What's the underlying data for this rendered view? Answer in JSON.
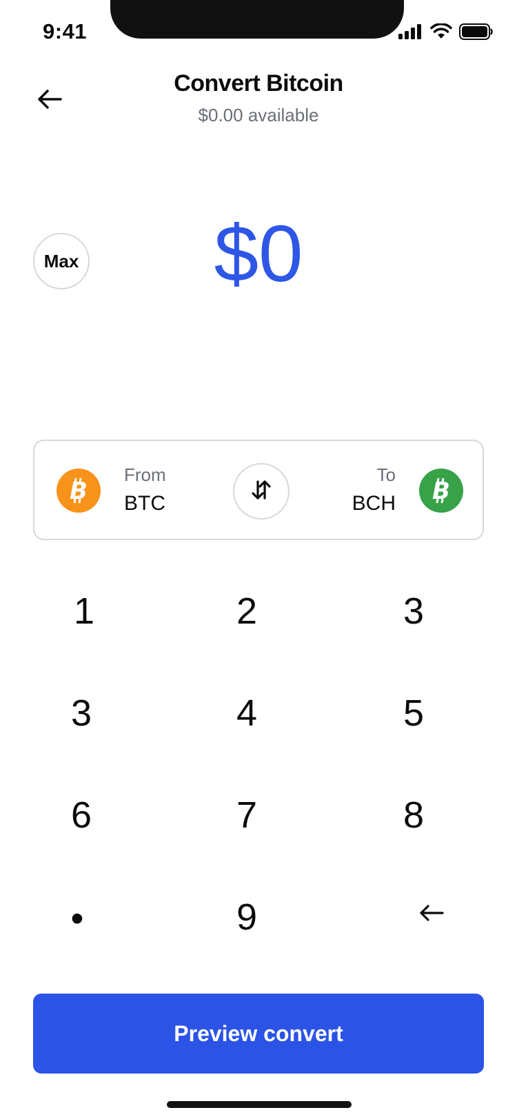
{
  "status_bar": {
    "time": "9:41"
  },
  "header": {
    "title": "Convert Bitcoin",
    "subtitle": "$0.00 available"
  },
  "amount": {
    "max_label": "Max",
    "value": "$0",
    "color": "#2f57e6"
  },
  "convert": {
    "from_label": "From",
    "from_symbol": "BTC",
    "from_icon": "bitcoin-icon",
    "from_color": "#f7931a",
    "to_label": "To",
    "to_symbol": "BCH",
    "to_icon": "bitcoin-cash-icon",
    "to_color": "#38a249"
  },
  "keypad": {
    "keys": [
      "1",
      "2",
      "3",
      "3",
      "4",
      "5",
      "6",
      "7",
      "8",
      "•",
      "9",
      "←"
    ]
  },
  "cta": {
    "label": "Preview convert",
    "color": "#2b53e6"
  }
}
